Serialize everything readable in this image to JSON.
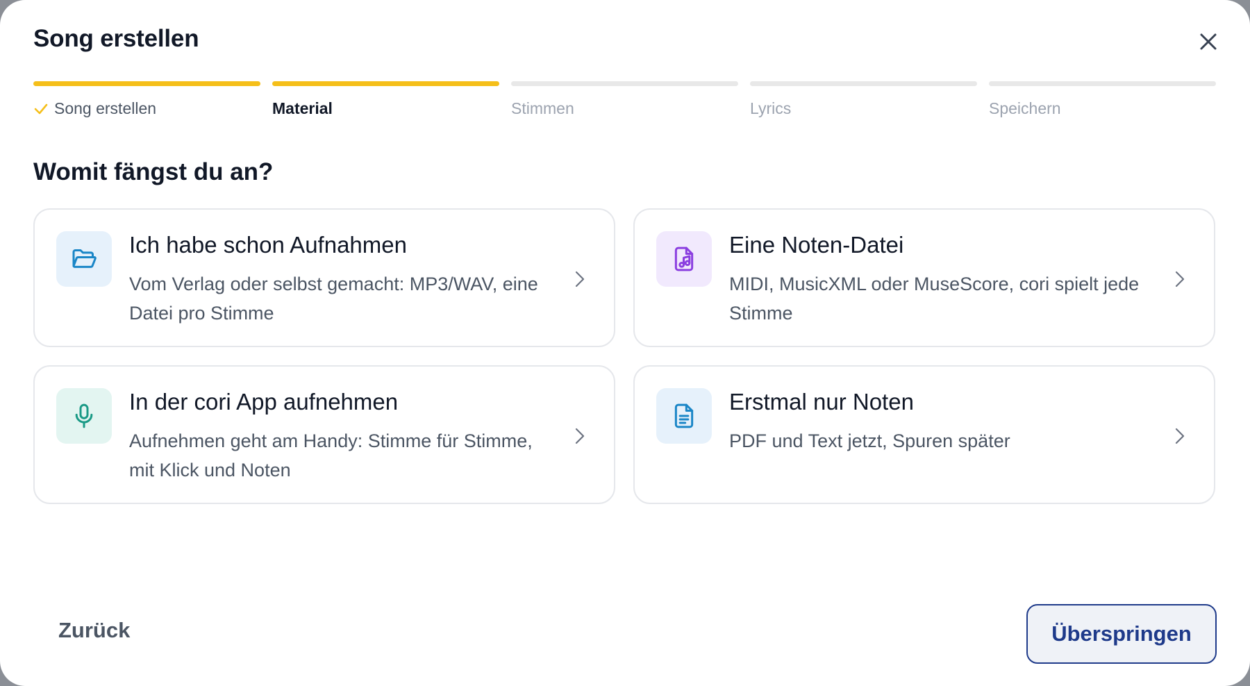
{
  "dialog": {
    "title": "Song erstellen",
    "close_icon": "close-icon"
  },
  "steps": [
    {
      "label": "Song erstellen",
      "state": "done",
      "icon": "check-icon"
    },
    {
      "label": "Material",
      "state": "current"
    },
    {
      "label": "Stimmen",
      "state": "upcoming"
    },
    {
      "label": "Lyrics",
      "state": "upcoming"
    },
    {
      "label": "Speichern",
      "state": "upcoming"
    }
  ],
  "question": "Womit fängst du an?",
  "options": [
    {
      "title": "Ich habe schon Aufnahmen",
      "description": "Vom Verlag oder selbst gemacht: MP3/WAV, eine Datei pro Stimme",
      "icon": "folder-open-icon",
      "icon_color": "#1a86c7",
      "icon_bg": "#e6f1fb"
    },
    {
      "title": "Eine Noten-Datei",
      "description": "MIDI, MusicXML oder MuseScore, cori spielt jede Stimme",
      "icon": "music-file-icon",
      "icon_color": "#8b3fe0",
      "icon_bg": "#f1e9fd"
    },
    {
      "title": "In der cori App aufnehmen",
      "description": "Aufnehmen geht am Handy: Stimme für Stimme, mit Klick und Noten",
      "icon": "microphone-icon",
      "icon_color": "#1a9a86",
      "icon_bg": "#e3f5f1"
    },
    {
      "title": "Erstmal nur Noten",
      "description": "PDF und Text jetzt, Spuren später",
      "icon": "document-icon",
      "icon_color": "#1a86c7",
      "icon_bg": "#e6f1fb"
    }
  ],
  "footer": {
    "back_label": "Zurück",
    "skip_label": "Überspringen"
  },
  "colors": {
    "progress_active": "#f5bf1a",
    "progress_inactive": "#e8e8e8",
    "primary": "#1e3a8a"
  }
}
